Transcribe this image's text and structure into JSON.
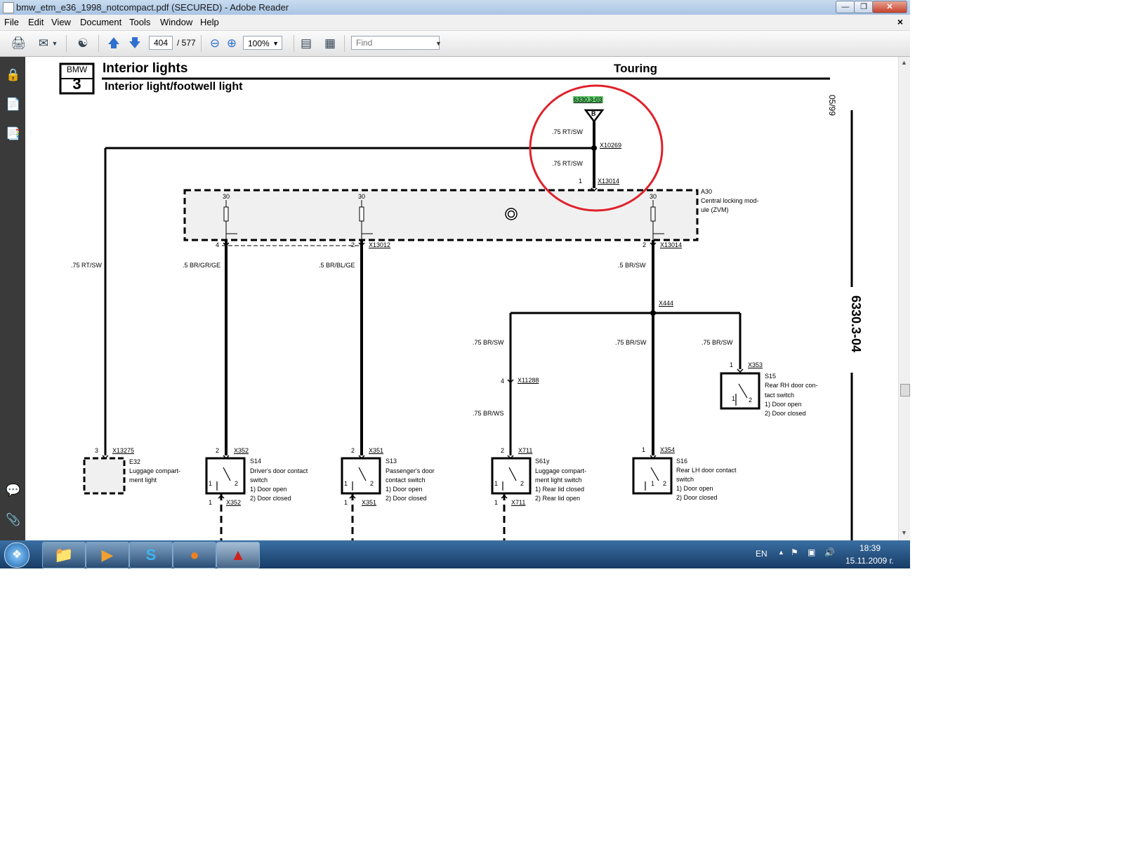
{
  "window": {
    "title": "bmw_etm_e36_1998_notcompact.pdf (SECURED) - Adobe Reader"
  },
  "menu": [
    "File",
    "Edit",
    "View",
    "Document",
    "Tools",
    "Window",
    "Help"
  ],
  "toolbar": {
    "page_current": "404",
    "page_total": "/ 577",
    "zoom": "100%",
    "find_placeholder": "Find"
  },
  "nav_icons": [
    "lock-icon",
    "pages-icon",
    "bookmarks-icon",
    "comments-icon",
    "attachments-icon"
  ],
  "drawing": {
    "brand_top": "BMW",
    "brand_num": "3",
    "title": "Interior lights",
    "variant": "Touring",
    "subtitle": "Interior light/footwell light",
    "date": "05/99",
    "page_code": "6330.3-04",
    "ref_code": "6330.3-03",
    "ref_letter": "B",
    "labels": {
      "w_top1": ".75 RT/SW",
      "w_top2": ".75 RT/SW",
      "x10269": "X10269",
      "x13014_top": "X13014",
      "pin1_top": "1",
      "a30": "A30",
      "a30_desc1": "Central locking mod-",
      "a30_desc2": "ule (ZVM)",
      "p30a": "30",
      "p30b": "30",
      "p30c": "30",
      "pin4": "4",
      "pin2a": "2",
      "pin2b": "2",
      "x13012": "X13012",
      "x13014_r": "X13014",
      "w_left": ".75 RT/SW",
      "w_brgrge": ".5 BR/GR/GE",
      "w_brblge": ".5 BR/BL/GE",
      "w_brsw": ".5 BR/SW",
      "x444": "X444",
      "w_brsw1": ".75 BR/SW",
      "w_brsw2": ".75 BR/SW",
      "w_brsw3": ".75 BR/SW",
      "pin4b": "4",
      "x11288": "X11288",
      "w_brws": ".75 BR/WS",
      "pin1_s15": "1",
      "x353": "X353",
      "s15": "S15",
      "s15_d1": "Rear RH door con-",
      "s15_d2": "tact switch",
      "s15_o1": "1)   Door open",
      "s15_o2": "2)   Door closed",
      "pin3": "3",
      "x13275": "X13275",
      "e32": "E32",
      "e32_d1": "Luggage compart-",
      "e32_d2": "ment light",
      "pin2_s14": "2",
      "x352": "X352",
      "s14": "S14",
      "s14_d1": "Driver's door contact",
      "s14_d2": "switch",
      "s14_o1": "1)   Door open",
      "s14_o2": "2)   Door closed",
      "pin1_s14": "1",
      "x352b": "X352",
      "pin2_s13": "2",
      "x351": "X351",
      "s13": "S13",
      "s13_d1": "Passenger's door",
      "s13_d2": "contact switch",
      "s13_o1": "1)   Door open",
      "s13_o2": "2)   Door closed",
      "pin1_s13": "1",
      "x351b": "X351",
      "pin2_s61": "2",
      "x711": "X711",
      "s61": "S61y",
      "s61_d1": "Luggage compart-",
      "s61_d2": "ment light switch",
      "s61_o1": "1)   Rear lid closed",
      "s61_o2": "2)   Rear lid open",
      "pin1_s61": "1",
      "x711b": "X711",
      "pin1_s16": "1",
      "x354": "X354",
      "s16": "S16",
      "s16_d1": "Rear LH door contact",
      "s16_d2": "switch",
      "s16_o1": "1)   Door open",
      "s16_o2": "2)   Door closed",
      "sw1": "1",
      "sw2": "2"
    }
  },
  "taskbar": {
    "lang": "EN",
    "time": "18:39",
    "date": "15.11.2009 г."
  },
  "colors": {
    "highlight_circle": "#e0202a",
    "ref_box": "#5ec86a"
  }
}
